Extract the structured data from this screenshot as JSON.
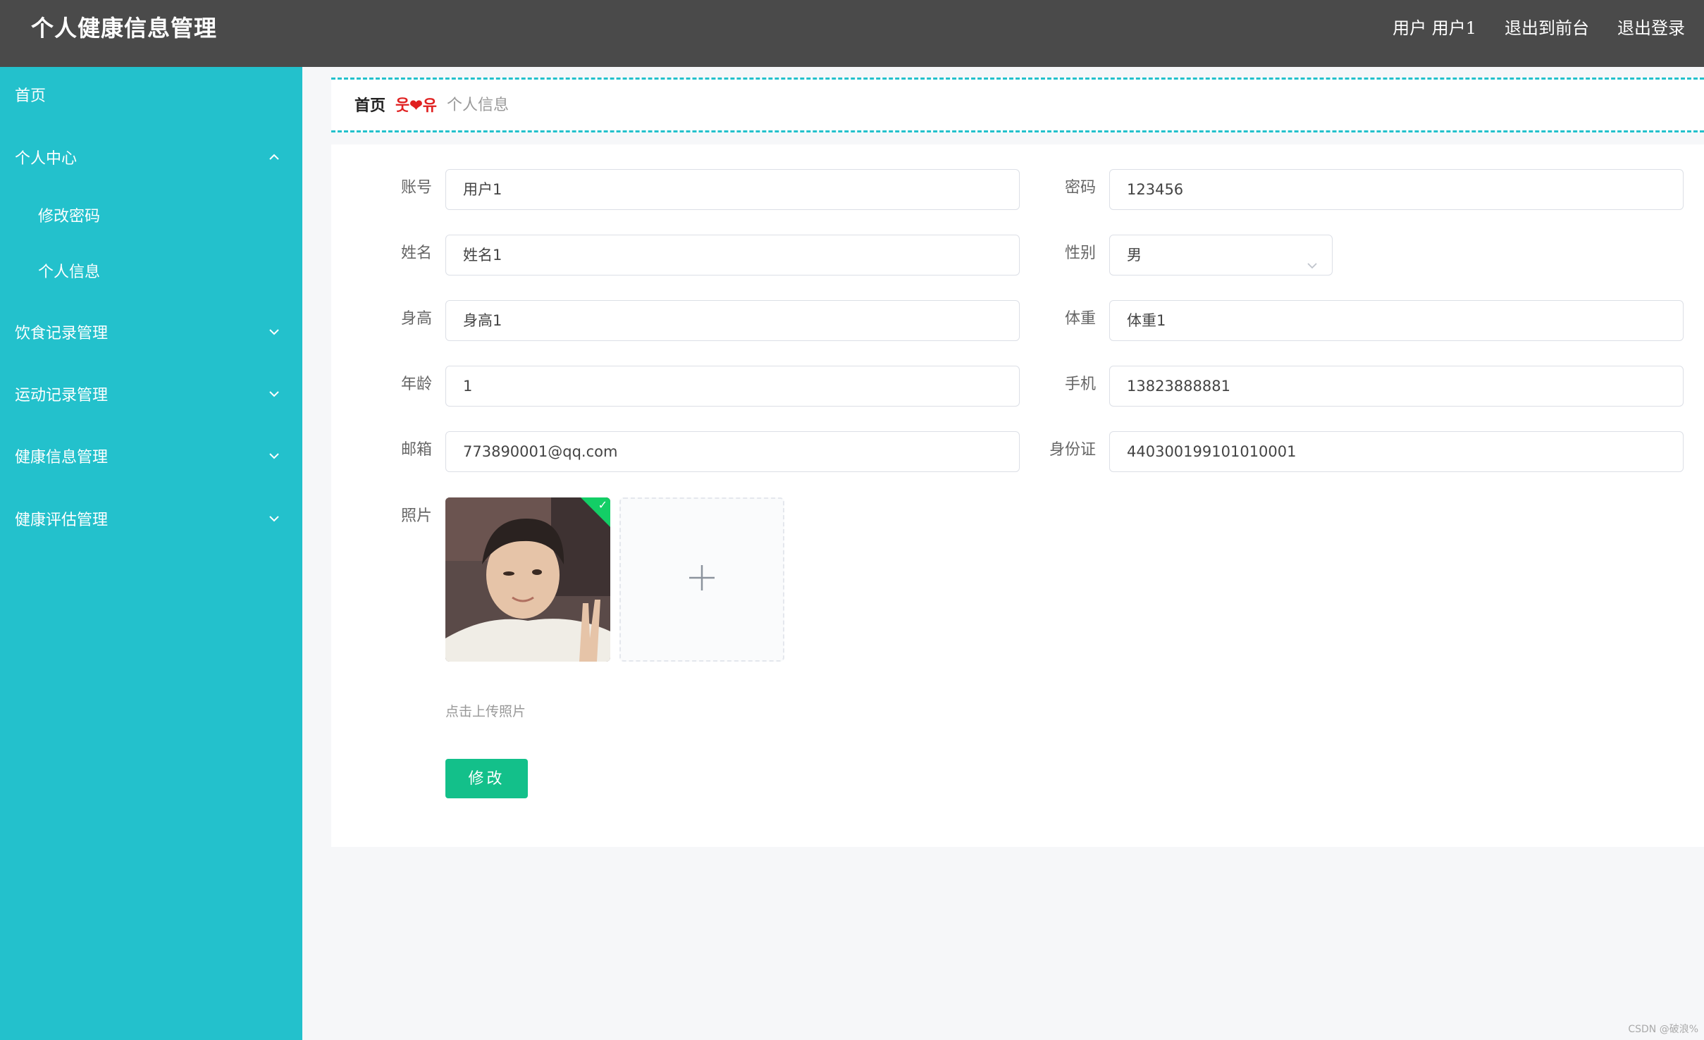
{
  "header": {
    "title": "个人健康信息管理",
    "user_label": "用户 用户1",
    "front_link": "退出到前台",
    "logout_link": "退出登录"
  },
  "sidebar": {
    "items": [
      {
        "label": "首页"
      },
      {
        "label": "个人中心",
        "expanded": true,
        "children": [
          {
            "label": "修改密码"
          },
          {
            "label": "个人信息"
          }
        ]
      },
      {
        "label": "饮食记录管理",
        "expanded": false
      },
      {
        "label": "运动记录管理",
        "expanded": false
      },
      {
        "label": "健康信息管理",
        "expanded": false
      },
      {
        "label": "健康评估管理",
        "expanded": false
      }
    ]
  },
  "breadcrumb": {
    "home": "首页",
    "separator": "웃❤유",
    "current": "个人信息"
  },
  "form": {
    "account": {
      "label": "账号",
      "value": "用户1"
    },
    "password": {
      "label": "密码",
      "value": "123456"
    },
    "name": {
      "label": "姓名",
      "value": "姓名1"
    },
    "gender": {
      "label": "性别",
      "value": "男"
    },
    "height": {
      "label": "身高",
      "value": "身高1"
    },
    "weight": {
      "label": "体重",
      "value": "体重1"
    },
    "age": {
      "label": "年龄",
      "value": "1"
    },
    "phone": {
      "label": "手机",
      "value": "13823888881"
    },
    "email": {
      "label": "邮箱",
      "value": "773890001@qq.com"
    },
    "id_card": {
      "label": "身份证",
      "value": "440300199101010001"
    },
    "photo": {
      "label": "照片",
      "hint": "点击上传照片"
    },
    "submit_label": "修改"
  },
  "watermark": "CSDN @破浪%",
  "colors": {
    "header_bg": "#4a4a4a",
    "sidebar_bg": "#23c1cc",
    "button_bg": "#13c08a",
    "separator": "#e02020"
  }
}
